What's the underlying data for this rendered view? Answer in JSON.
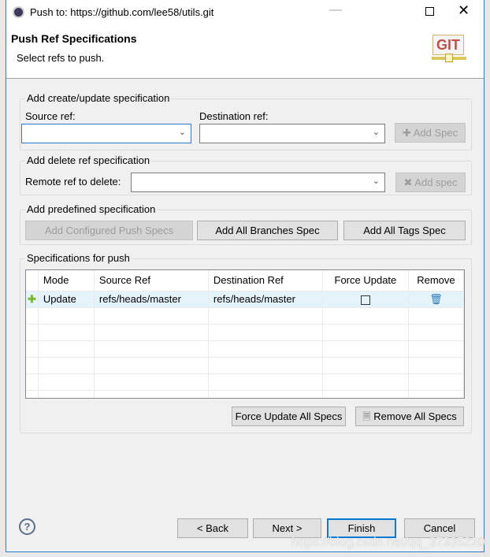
{
  "window": {
    "title": "Push to: https://github.com/lee58/utils.git"
  },
  "header": {
    "title": "Push Ref Specifications",
    "subtitle": "Select refs to push.",
    "logo_text": "GIT"
  },
  "create_group": {
    "title": "Add create/update specification",
    "source_label": "Source ref:",
    "source_value": "",
    "dest_label": "Destination ref:",
    "dest_value": "",
    "add_button": "Add Spec"
  },
  "delete_group": {
    "title": "Add delete ref specification",
    "remote_label": "Remote ref to delete:",
    "remote_value": "",
    "add_button": "Add spec"
  },
  "predefined_group": {
    "title": "Add predefined specification",
    "buttons": [
      "Add Configured Push Specs",
      "Add All Branches Spec",
      "Add All Tags Spec"
    ]
  },
  "specs_group": {
    "title": "Specifications for push",
    "columns": [
      "Mode",
      "Source Ref",
      "Destination Ref",
      "Force Update",
      "Remove"
    ],
    "rows": [
      {
        "mode": "Update",
        "source": "refs/heads/master",
        "dest": "refs/heads/master",
        "force": false
      }
    ],
    "force_all_button": "Force Update All Specs",
    "remove_all_button": "Remove All Specs"
  },
  "footer": {
    "back": "< Back",
    "next": "Next >",
    "finish": "Finish",
    "cancel": "Cancel"
  },
  "watermark": "https://blog.csdn.net/qq_37335220"
}
